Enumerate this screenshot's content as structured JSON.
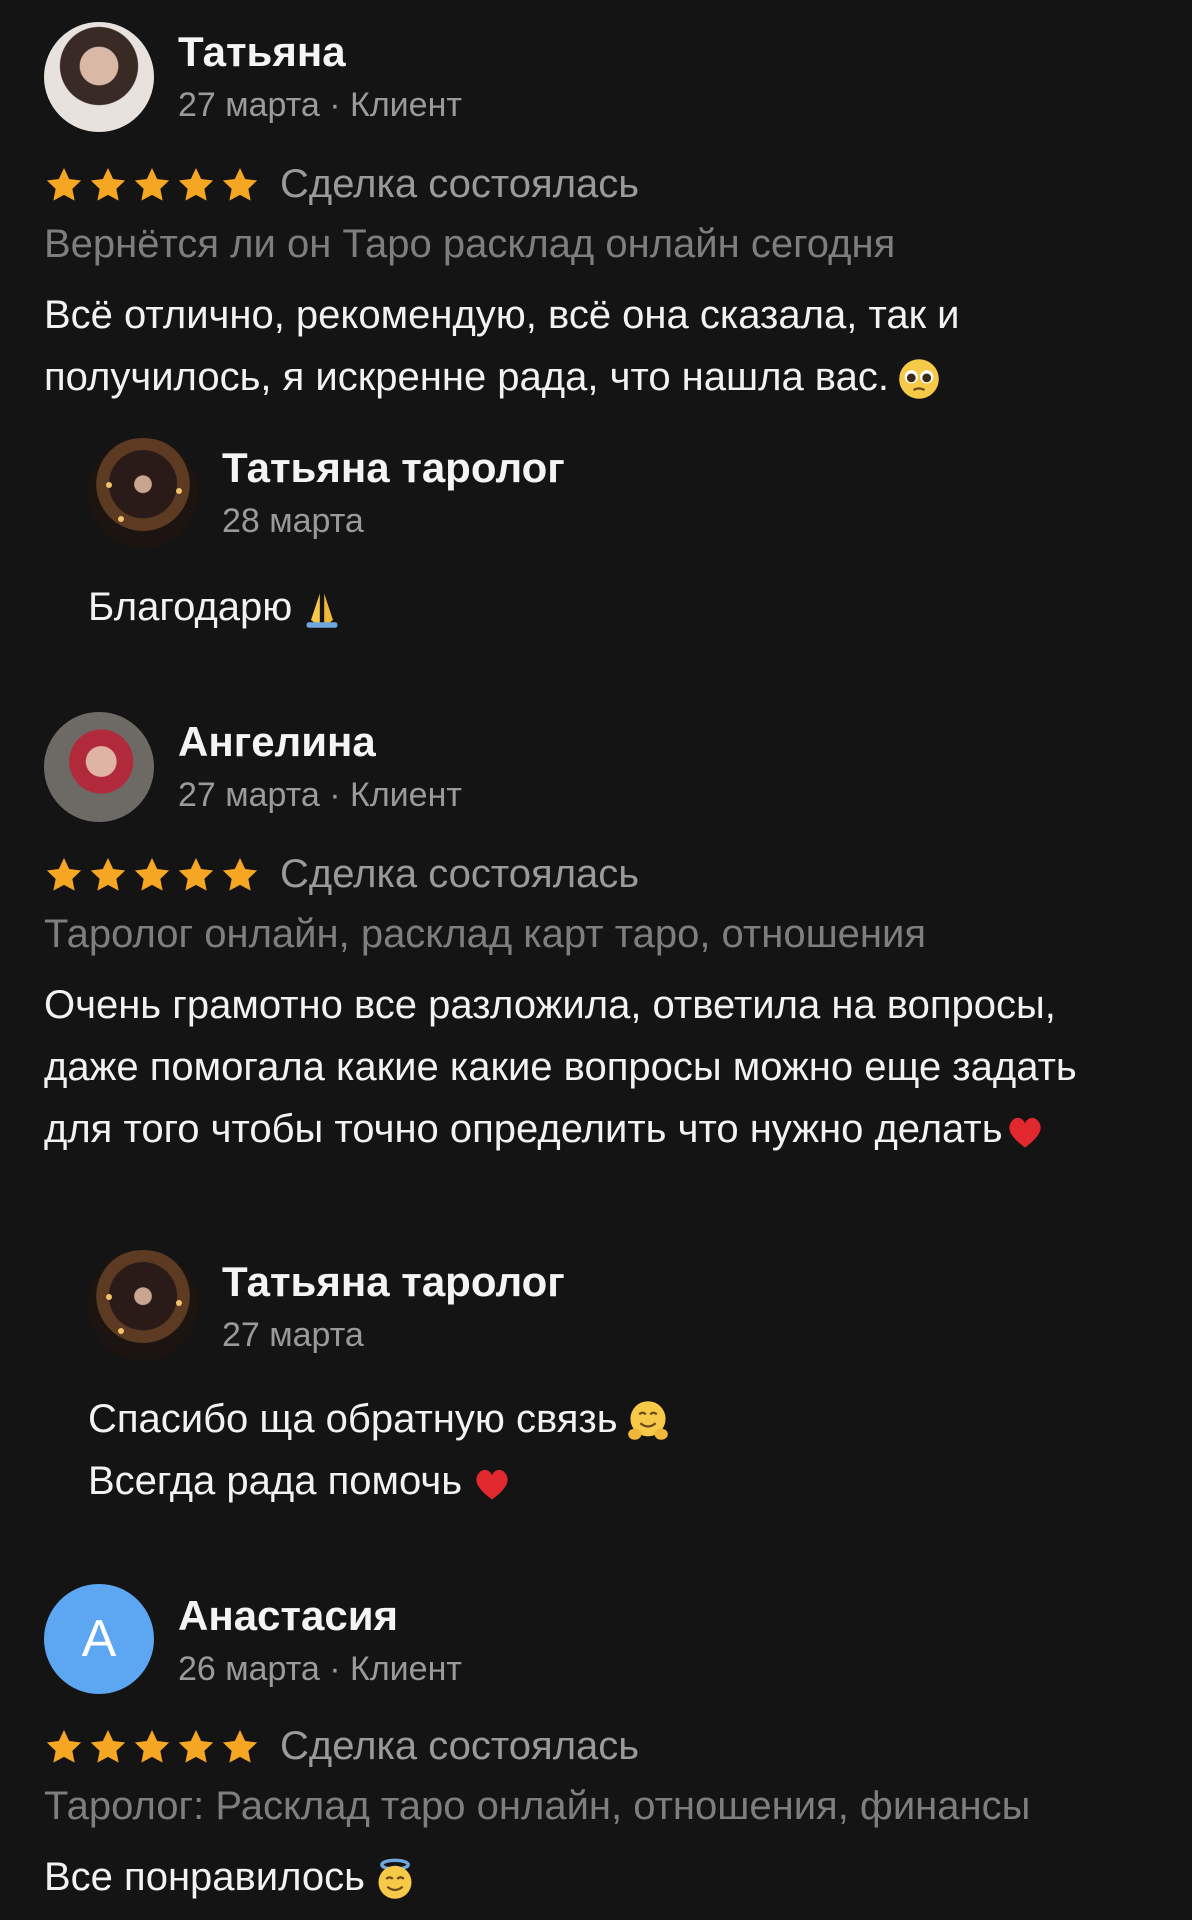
{
  "reviews": [
    {
      "author": "Татьяна",
      "meta": "27 марта · Клиент",
      "rating": 5,
      "deal": "Сделка состоялась",
      "topic": "Вернётся ли он Таро расклад онлайн сегодня",
      "text": "Всё отлично, рекомендую, всё она сказала, так и получилось, я искренне рада, что нашла вас.",
      "text_emoji": "pleading-face-emoji",
      "reply": {
        "author": "Татьяна таролог",
        "date": "28 марта",
        "text": "Благодарю",
        "emoji": "praying-hands-emoji"
      }
    },
    {
      "author": "Ангелина",
      "meta": "27 марта · Клиент",
      "rating": 5,
      "deal": "Сделка состоялась",
      "topic": "Таролог онлайн, расклад карт таро, отношения",
      "text": "Очень грамотно все разложила, ответила на вопросы, даже помогала какие какие вопросы можно еще задать для того чтобы точно определить что нужно делать",
      "text_emoji": "red-heart-emoji",
      "reply": {
        "author": "Татьяна таролог",
        "date": "27 марта",
        "line1": "Спасибо ща обратную связь",
        "line1_emoji": "hugging-face-emoji",
        "line2": "Всегда рада помочь",
        "line2_emoji": "red-heart-emoji"
      }
    },
    {
      "author": "Анастасия",
      "avatar_letter": "А",
      "avatar_color": "#5ca6f2",
      "meta": "26 марта · Клиент",
      "rating": 5,
      "deal": "Сделка состоялась",
      "topic": "Таролог: Расклад таро онлайн, отношения, финансы",
      "text": "Все понравилось",
      "text_emoji": "smiling-face-with-halo-emoji"
    }
  ],
  "colors": {
    "background": "#141414",
    "star": "#f5a623",
    "muted": "#9a9a9a",
    "topic": "#7e7e7e"
  }
}
